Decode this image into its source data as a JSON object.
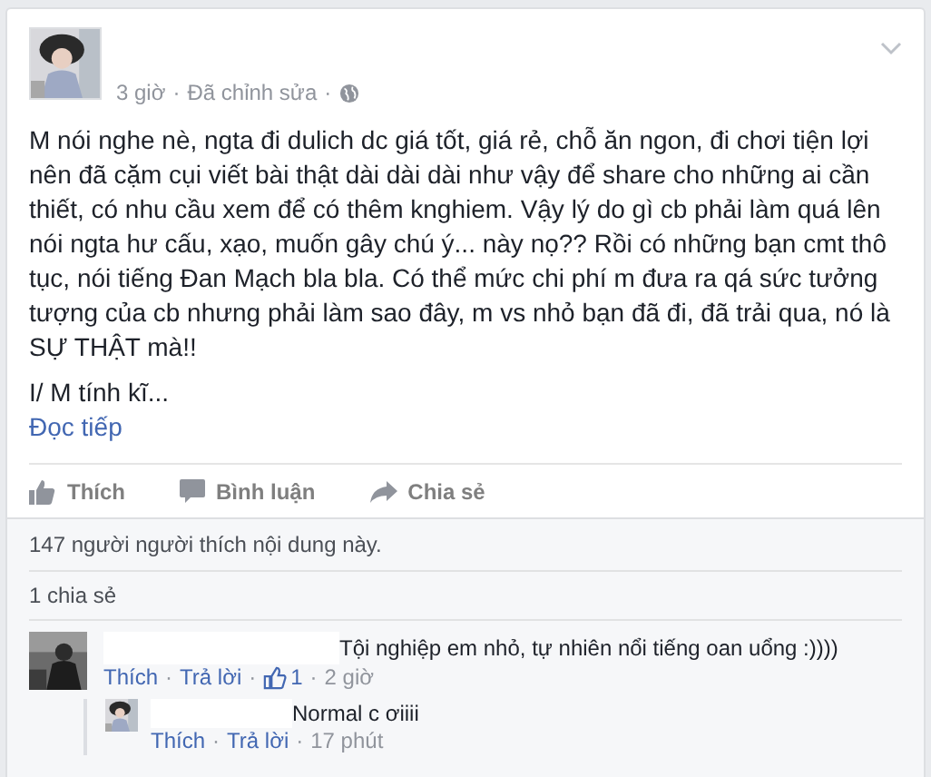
{
  "separator": "·",
  "post": {
    "time": "3 giờ",
    "edited": "Đã chỉnh sửa",
    "paragraphs": [
      "M nói nghe nè, ngta đi dulich dc giá tốt, giá rẻ, chỗ ăn ngon, đi chơi tiện lợi nên đã cặm cụi viết bài thật dài dài dài như vậy để share cho những ai cần thiết, có nhu cầu xem để có thêm knghiem. Vậy lý do gì cb phải làm quá lên nói ngta hư cấu, xạo, muốn gây chú ý... này nọ?? Rồi có những bạn cmt thô tục, nói tiếng Đan Mạch bla bla. Có thể mức chi phí m đưa ra qá sức tưởng tượng của cb nhưng phải làm sao đây, m vs nhỏ bạn đã đi, đã trải qua, nó là SỰ THẬT mà!!",
      "I/ M tính kĩ..."
    ],
    "read_more": "Đọc tiếp"
  },
  "actions": [
    "Thích",
    "Bình luận",
    "Chia sẻ"
  ],
  "likes_summary": "147 người người thích nội dung này.",
  "shares_summary": "1 chia sẻ",
  "comments": [
    {
      "text": "Tội nghiệp em nhỏ, tự nhiên nổi tiếng oan uổng :))))",
      "like": "Thích",
      "reply": "Trả lời",
      "like_count": "1",
      "time": "2 giờ",
      "replies": [
        {
          "text": "Normal c ơiiii",
          "like": "Thích",
          "reply": "Trả lời",
          "time": "17 phút"
        }
      ]
    }
  ]
}
